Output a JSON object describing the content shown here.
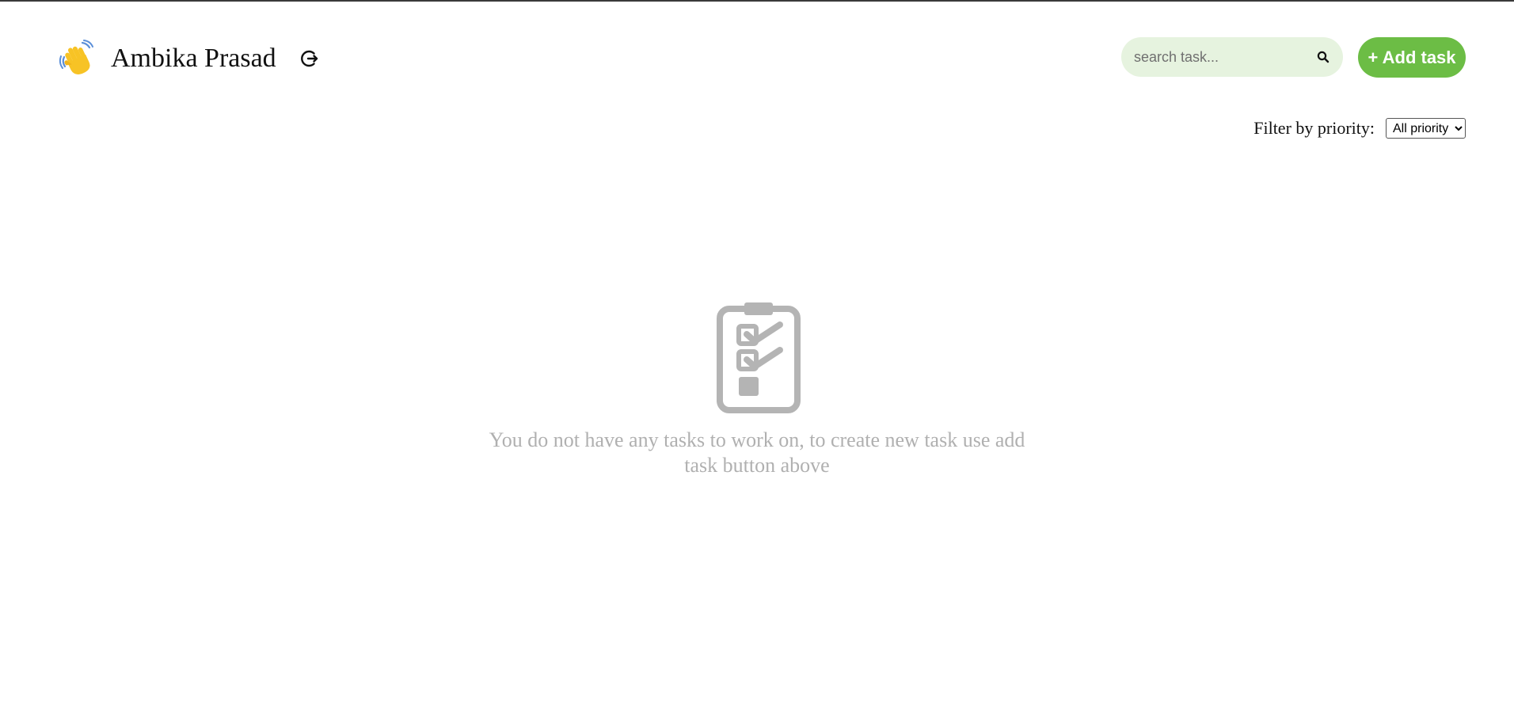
{
  "header": {
    "user_name": "Ambika Prasad",
    "greeting_icon": "waving-hand-icon",
    "logout_icon": "logout-icon"
  },
  "search": {
    "placeholder": "search task...",
    "value": "",
    "icon": "search-icon",
    "background_color": "#e6f3df"
  },
  "actions": {
    "add_task_label": "+ Add task",
    "accent_color": "#6cbd45"
  },
  "filter": {
    "label": "Filter by priority:",
    "selected": "All priority",
    "options": [
      "All priority"
    ]
  },
  "empty_state": {
    "icon": "clipboard-checklist-icon",
    "message": "You do not have any tasks to work on, to create new task use add task button above",
    "text_color": "#b0b0b0"
  }
}
